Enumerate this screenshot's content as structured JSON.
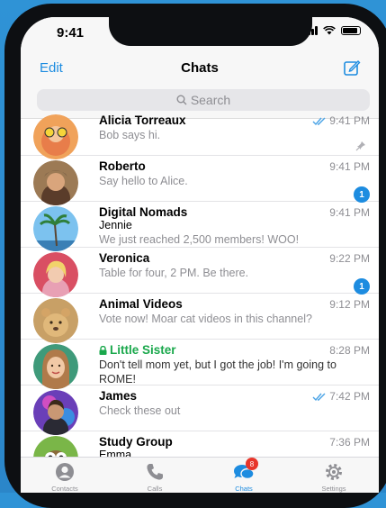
{
  "status_bar": {
    "time": "9:41"
  },
  "nav": {
    "edit_label": "Edit",
    "title": "Chats",
    "compose_icon": "compose-icon"
  },
  "search": {
    "placeholder": "Search"
  },
  "accent_color": "#1d8ce0",
  "chats": [
    {
      "name": "Alicia Torreaux",
      "sender": "",
      "message": "Bob says hi.",
      "time": "9:41 PM",
      "read_ticks": true,
      "badge": "",
      "pinned": true,
      "secret": false
    },
    {
      "name": "Roberto",
      "sender": "",
      "message": "Say hello to Alice.",
      "time": "9:41 PM",
      "read_ticks": false,
      "badge": "1",
      "pinned": false,
      "secret": false
    },
    {
      "name": "Digital Nomads",
      "sender": "Jennie",
      "message": "We just reached 2,500 members! WOO!",
      "time": "9:41 PM",
      "read_ticks": false,
      "badge": "",
      "pinned": false,
      "secret": false
    },
    {
      "name": "Veronica",
      "sender": "",
      "message": "Table for four, 2 PM. Be there.",
      "time": "9:22 PM",
      "read_ticks": false,
      "badge": "1",
      "pinned": false,
      "secret": false
    },
    {
      "name": "Animal Videos",
      "sender": "",
      "message": "Vote now! Moar cat videos in this channel?",
      "time": "9:12 PM",
      "read_ticks": false,
      "badge": "",
      "pinned": false,
      "secret": false
    },
    {
      "name": "Little Sister",
      "sender": "",
      "message": "Don't tell mom yet, but I got the job! I'm going to ROME!",
      "time": "8:28 PM",
      "read_ticks": false,
      "badge": "",
      "pinned": false,
      "secret": true
    },
    {
      "name": "James",
      "sender": "",
      "message": "Check these out",
      "time": "7:42 PM",
      "read_ticks": true,
      "badge": "",
      "pinned": false,
      "secret": false
    },
    {
      "name": "Study Group",
      "sender": "Emma",
      "message": "",
      "time": "7:36 PM",
      "read_ticks": false,
      "badge": "",
      "pinned": false,
      "secret": false
    }
  ],
  "tabs": [
    {
      "label": "Contacts",
      "icon": "contacts-icon",
      "active": false,
      "badge": ""
    },
    {
      "label": "Calls",
      "icon": "phone-icon",
      "active": false,
      "badge": ""
    },
    {
      "label": "Chats",
      "icon": "chat-bubbles-icon",
      "active": true,
      "badge": "8"
    },
    {
      "label": "Settings",
      "icon": "gear-icon",
      "active": false,
      "badge": ""
    }
  ]
}
